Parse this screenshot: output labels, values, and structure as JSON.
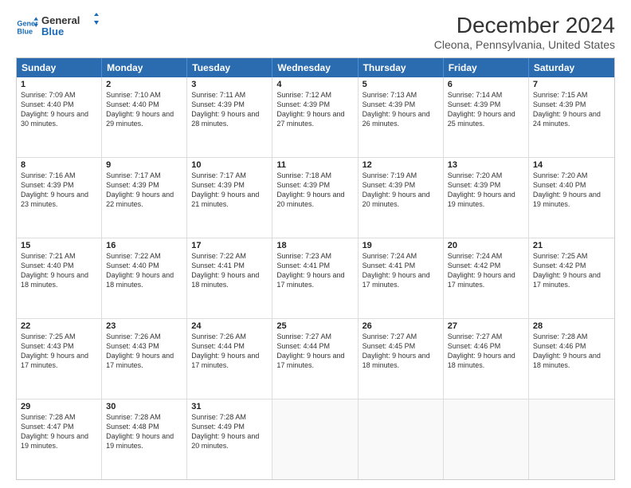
{
  "logo": {
    "line1": "General",
    "line2": "Blue"
  },
  "title": "December 2024",
  "subtitle": "Cleona, Pennsylvania, United States",
  "weekdays": [
    "Sunday",
    "Monday",
    "Tuesday",
    "Wednesday",
    "Thursday",
    "Friday",
    "Saturday"
  ],
  "weeks": [
    [
      {
        "day": "1",
        "rise": "Sunrise: 7:09 AM",
        "set": "Sunset: 4:40 PM",
        "light": "Daylight: 9 hours and 30 minutes."
      },
      {
        "day": "2",
        "rise": "Sunrise: 7:10 AM",
        "set": "Sunset: 4:40 PM",
        "light": "Daylight: 9 hours and 29 minutes."
      },
      {
        "day": "3",
        "rise": "Sunrise: 7:11 AM",
        "set": "Sunset: 4:39 PM",
        "light": "Daylight: 9 hours and 28 minutes."
      },
      {
        "day": "4",
        "rise": "Sunrise: 7:12 AM",
        "set": "Sunset: 4:39 PM",
        "light": "Daylight: 9 hours and 27 minutes."
      },
      {
        "day": "5",
        "rise": "Sunrise: 7:13 AM",
        "set": "Sunset: 4:39 PM",
        "light": "Daylight: 9 hours and 26 minutes."
      },
      {
        "day": "6",
        "rise": "Sunrise: 7:14 AM",
        "set": "Sunset: 4:39 PM",
        "light": "Daylight: 9 hours and 25 minutes."
      },
      {
        "day": "7",
        "rise": "Sunrise: 7:15 AM",
        "set": "Sunset: 4:39 PM",
        "light": "Daylight: 9 hours and 24 minutes."
      }
    ],
    [
      {
        "day": "8",
        "rise": "Sunrise: 7:16 AM",
        "set": "Sunset: 4:39 PM",
        "light": "Daylight: 9 hours and 23 minutes."
      },
      {
        "day": "9",
        "rise": "Sunrise: 7:17 AM",
        "set": "Sunset: 4:39 PM",
        "light": "Daylight: 9 hours and 22 minutes."
      },
      {
        "day": "10",
        "rise": "Sunrise: 7:17 AM",
        "set": "Sunset: 4:39 PM",
        "light": "Daylight: 9 hours and 21 minutes."
      },
      {
        "day": "11",
        "rise": "Sunrise: 7:18 AM",
        "set": "Sunset: 4:39 PM",
        "light": "Daylight: 9 hours and 20 minutes."
      },
      {
        "day": "12",
        "rise": "Sunrise: 7:19 AM",
        "set": "Sunset: 4:39 PM",
        "light": "Daylight: 9 hours and 20 minutes."
      },
      {
        "day": "13",
        "rise": "Sunrise: 7:20 AM",
        "set": "Sunset: 4:39 PM",
        "light": "Daylight: 9 hours and 19 minutes."
      },
      {
        "day": "14",
        "rise": "Sunrise: 7:20 AM",
        "set": "Sunset: 4:40 PM",
        "light": "Daylight: 9 hours and 19 minutes."
      }
    ],
    [
      {
        "day": "15",
        "rise": "Sunrise: 7:21 AM",
        "set": "Sunset: 4:40 PM",
        "light": "Daylight: 9 hours and 18 minutes."
      },
      {
        "day": "16",
        "rise": "Sunrise: 7:22 AM",
        "set": "Sunset: 4:40 PM",
        "light": "Daylight: 9 hours and 18 minutes."
      },
      {
        "day": "17",
        "rise": "Sunrise: 7:22 AM",
        "set": "Sunset: 4:41 PM",
        "light": "Daylight: 9 hours and 18 minutes."
      },
      {
        "day": "18",
        "rise": "Sunrise: 7:23 AM",
        "set": "Sunset: 4:41 PM",
        "light": "Daylight: 9 hours and 17 minutes."
      },
      {
        "day": "19",
        "rise": "Sunrise: 7:24 AM",
        "set": "Sunset: 4:41 PM",
        "light": "Daylight: 9 hours and 17 minutes."
      },
      {
        "day": "20",
        "rise": "Sunrise: 7:24 AM",
        "set": "Sunset: 4:42 PM",
        "light": "Daylight: 9 hours and 17 minutes."
      },
      {
        "day": "21",
        "rise": "Sunrise: 7:25 AM",
        "set": "Sunset: 4:42 PM",
        "light": "Daylight: 9 hours and 17 minutes."
      }
    ],
    [
      {
        "day": "22",
        "rise": "Sunrise: 7:25 AM",
        "set": "Sunset: 4:43 PM",
        "light": "Daylight: 9 hours and 17 minutes."
      },
      {
        "day": "23",
        "rise": "Sunrise: 7:26 AM",
        "set": "Sunset: 4:43 PM",
        "light": "Daylight: 9 hours and 17 minutes."
      },
      {
        "day": "24",
        "rise": "Sunrise: 7:26 AM",
        "set": "Sunset: 4:44 PM",
        "light": "Daylight: 9 hours and 17 minutes."
      },
      {
        "day": "25",
        "rise": "Sunrise: 7:27 AM",
        "set": "Sunset: 4:44 PM",
        "light": "Daylight: 9 hours and 17 minutes."
      },
      {
        "day": "26",
        "rise": "Sunrise: 7:27 AM",
        "set": "Sunset: 4:45 PM",
        "light": "Daylight: 9 hours and 18 minutes."
      },
      {
        "day": "27",
        "rise": "Sunrise: 7:27 AM",
        "set": "Sunset: 4:46 PM",
        "light": "Daylight: 9 hours and 18 minutes."
      },
      {
        "day": "28",
        "rise": "Sunrise: 7:28 AM",
        "set": "Sunset: 4:46 PM",
        "light": "Daylight: 9 hours and 18 minutes."
      }
    ],
    [
      {
        "day": "29",
        "rise": "Sunrise: 7:28 AM",
        "set": "Sunset: 4:47 PM",
        "light": "Daylight: 9 hours and 19 minutes."
      },
      {
        "day": "30",
        "rise": "Sunrise: 7:28 AM",
        "set": "Sunset: 4:48 PM",
        "light": "Daylight: 9 hours and 19 minutes."
      },
      {
        "day": "31",
        "rise": "Sunrise: 7:28 AM",
        "set": "Sunset: 4:49 PM",
        "light": "Daylight: 9 hours and 20 minutes."
      },
      null,
      null,
      null,
      null
    ]
  ]
}
